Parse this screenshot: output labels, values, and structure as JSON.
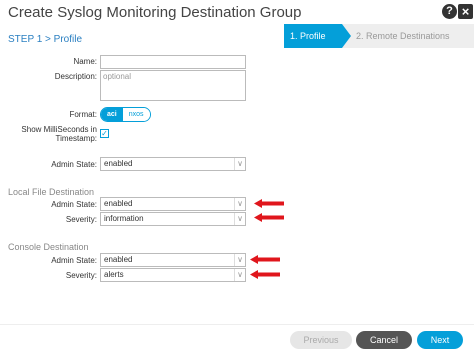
{
  "dialog": {
    "title": "Create Syslog Monitoring Destination Group",
    "help_glyph": "?",
    "close_glyph": "×"
  },
  "wizard": {
    "step_label": "STEP 1 > Profile",
    "steps": [
      "1. Profile",
      "2. Remote Destinations"
    ],
    "active_step": 1
  },
  "form": {
    "name": {
      "label": "Name:",
      "value": ""
    },
    "description": {
      "label": "Description:",
      "placeholder": "optional"
    },
    "format": {
      "label": "Format:",
      "options": [
        "aci",
        "nxos"
      ],
      "selected": "aci"
    },
    "show_ms": {
      "label_line1": "Show MilliSeconds in",
      "label_line2": "Timestamp:",
      "checked": true,
      "check_glyph": "✓"
    },
    "admin_state": {
      "label": "Admin State:",
      "value": "enabled"
    }
  },
  "local_file": {
    "heading": "Local File Destination",
    "admin_state": {
      "label": "Admin State:",
      "value": "enabled"
    },
    "severity": {
      "label": "Severity:",
      "value": "information"
    }
  },
  "console": {
    "heading": "Console Destination",
    "admin_state": {
      "label": "Admin State:",
      "value": "enabled"
    },
    "severity": {
      "label": "Severity:",
      "value": "alerts"
    }
  },
  "footer": {
    "previous": "Previous",
    "cancel": "Cancel",
    "next": "Next"
  },
  "colors": {
    "accent": "#049fd9",
    "annotation_arrow": "#e0161c"
  }
}
